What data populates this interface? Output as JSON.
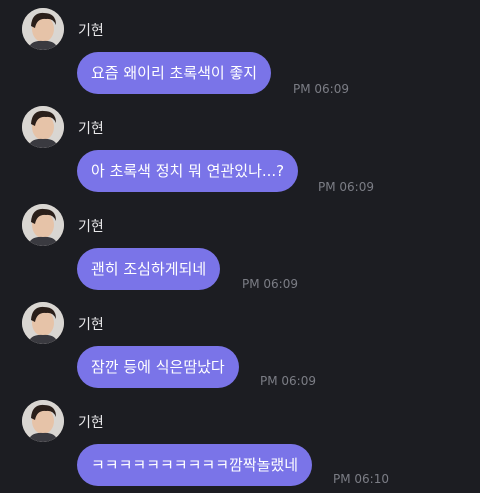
{
  "sender": {
    "name": "기현",
    "avatar_icon": "profile-photo"
  },
  "messages": [
    {
      "text": "요즘 왜이리 초록색이 좋지",
      "time": "PM 06:09"
    },
    {
      "text": "아 초록색 정치 뭐 연관있나...?",
      "time": "PM 06:09"
    },
    {
      "text": "괜히 조심하게되네",
      "time": "PM 06:09"
    },
    {
      "text": "잠깐 등에 식은땀났다",
      "time": "PM 06:09"
    },
    {
      "text": "ㅋㅋㅋㅋㅋㅋㅋㅋㅋㅋ깜짝놀랬네",
      "time": "PM 06:10"
    }
  ],
  "colors": {
    "background": "#1c1d22",
    "bubble": "#7a74e8",
    "bubble_text": "#ffffff",
    "name_text": "#e8e8ea",
    "time_text": "#7b7d85"
  }
}
